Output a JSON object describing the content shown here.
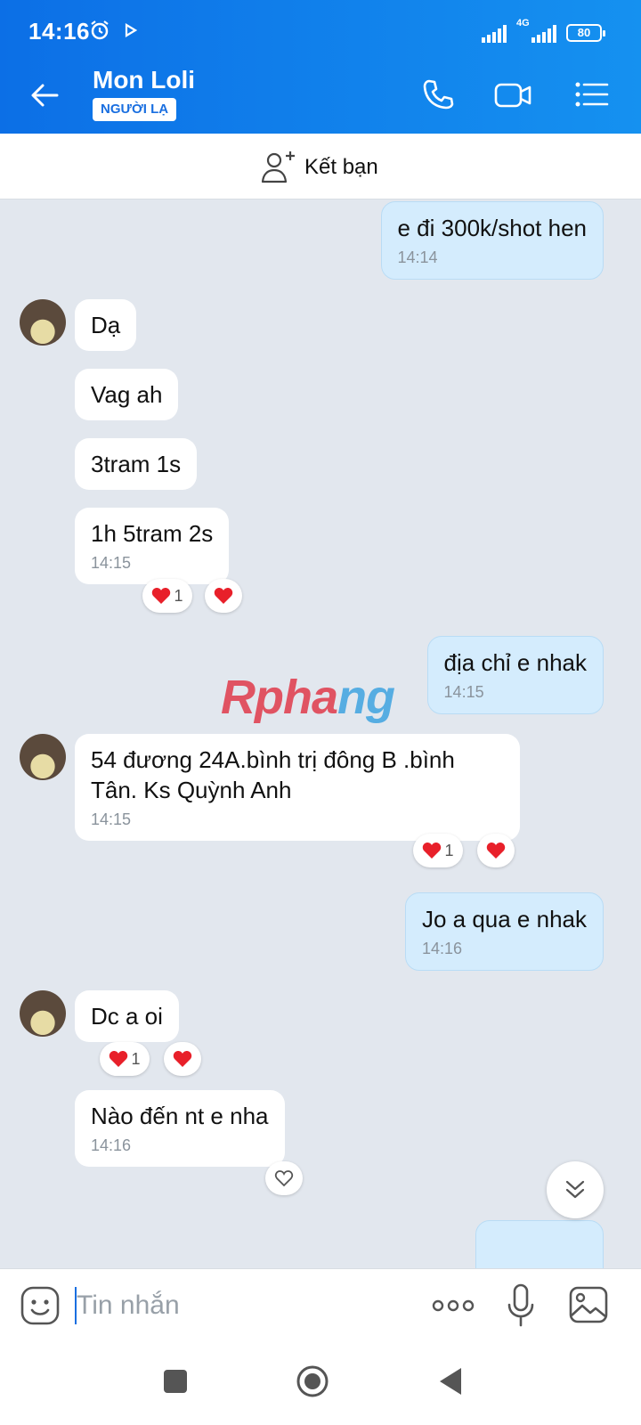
{
  "status_bar": {
    "time": "14:16",
    "network": "4G",
    "battery": "80"
  },
  "header": {
    "contact_name": "Mon Loli",
    "badge": "NGƯỜI LẠ"
  },
  "add_friend": {
    "label": "Kết bạn"
  },
  "messages": [
    {
      "dir": "out",
      "text": "e đi 300k/shot hen",
      "time": "14:14"
    },
    {
      "dir": "in",
      "text": "Dạ"
    },
    {
      "dir": "in",
      "text": "Vag ah"
    },
    {
      "dir": "in",
      "text": "3tram 1s"
    },
    {
      "dir": "in",
      "text": "1h 5tram 2s",
      "time": "14:15",
      "reaction_count": "1"
    },
    {
      "dir": "out",
      "text": "địa chỉ e nhak",
      "time": "14:15"
    },
    {
      "dir": "in",
      "text": "54 đương 24A.bình trị đông B .bình Tân. Ks Quỳnh Anh",
      "time": "14:15",
      "reaction_count": "1"
    },
    {
      "dir": "out",
      "text": "Jo a qua e nhak",
      "time": "14:16"
    },
    {
      "dir": "in",
      "text": "Dc a oi",
      "reaction_count": "1"
    },
    {
      "dir": "in",
      "text": "Nào đến  nt e nha",
      "time": "14:16"
    }
  ],
  "watermark": {
    "part1": "Rpha",
    "part2": "ng"
  },
  "input": {
    "placeholder": "Tin nhắn"
  },
  "colors": {
    "header": "#0c6fe6",
    "outgoing_bubble": "#d4ecfd",
    "chat_bg": "#e2e7ee",
    "heart": "#e8202a"
  }
}
